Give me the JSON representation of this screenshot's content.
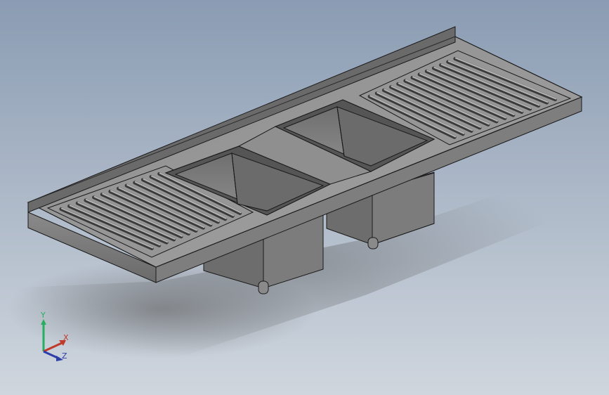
{
  "viewport": {
    "colors": {
      "background_top": "#8a9cb3",
      "background_bottom": "#cfd6de",
      "metal_light": "#9a9a9a",
      "metal_mid": "#7a7a7a",
      "metal_dark": "#4f4f4f",
      "edge": "#1a1a1a"
    },
    "model": {
      "sinks": 2,
      "drainboards": 2,
      "ribs_per_drainboard": 13
    }
  },
  "triad": {
    "x_label": "X",
    "y_label": "Y",
    "z_label": "Z",
    "x_color": "#c0392b",
    "y_color": "#27ae60",
    "z_color": "#2c3ea8"
  }
}
